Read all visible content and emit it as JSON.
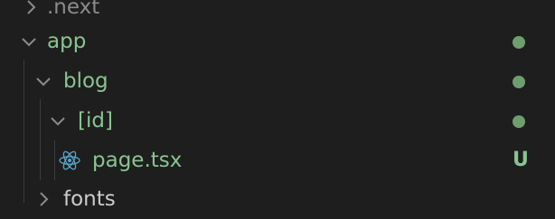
{
  "explorer": {
    "items": [
      {
        "label": ".next",
        "expanded": false,
        "status": ""
      },
      {
        "label": "app",
        "expanded": true,
        "status": "dot"
      },
      {
        "label": "blog",
        "expanded": true,
        "status": "dot"
      },
      {
        "label": "[id]",
        "expanded": true,
        "status": "dot"
      },
      {
        "label": "page.tsx",
        "icon": "react-icon",
        "status": "U"
      },
      {
        "label": "fonts",
        "expanded": false,
        "status": ""
      }
    ]
  },
  "colors": {
    "background": "#1e1e1e",
    "modified_text": "#89c490",
    "dim_text": "#8b8b8b",
    "status_dot": "#6e9e6e",
    "react_icon": "#5aa7c8"
  }
}
